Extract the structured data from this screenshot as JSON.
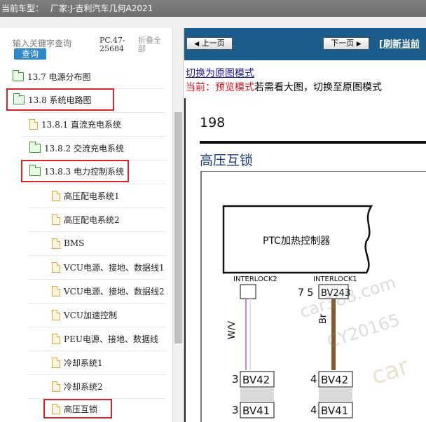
{
  "title_bar": {
    "vehicle_label": "当前车型：",
    "manufacturer": "厂家:J-吉利汽车几何A2021"
  },
  "left_panel": {
    "search_placeholder": "输入关键字查询",
    "query_button": "查询",
    "version_line1": "PC.47-",
    "version_line2": "25684",
    "collapse_line1": "折叠全",
    "collapse_line2": "部",
    "tree": [
      {
        "label": "13.7 电源分布图",
        "icon": "folder-icon"
      },
      {
        "label": "13.8 系统电路图",
        "icon": "folder-icon",
        "highlighted": true
      },
      {
        "label": "13.8.1 直流充电系统",
        "icon": "page-icon"
      },
      {
        "label": "13.8.2 交流充电系统",
        "icon": "folder-icon"
      },
      {
        "label": "13.8.3 电力控制系统",
        "icon": "folder-icon",
        "highlighted": true
      },
      {
        "label": "高压配电系统1",
        "icon": "page-icon"
      },
      {
        "label": "高压配电系统2",
        "icon": "page-icon"
      },
      {
        "label": "BMS",
        "icon": "page-icon"
      },
      {
        "label": "VCU电源、接地、数据线1",
        "icon": "page-icon"
      },
      {
        "label": "VCU电源、接地、数据线2",
        "icon": "page-icon"
      },
      {
        "label": "VCU加速控制",
        "icon": "page-icon"
      },
      {
        "label": "PEU电源、接地、数据线",
        "icon": "page-icon"
      },
      {
        "label": "冷却系统1",
        "icon": "page-icon"
      },
      {
        "label": "冷却系统2",
        "icon": "page-icon"
      },
      {
        "label": "高压互锁",
        "icon": "page-icon",
        "highlighted": true
      }
    ]
  },
  "viewer": {
    "prev_button": "上一页",
    "next_button": "下一页",
    "refresh_link": "[刷新当前",
    "switch_link": "切换为原图模式",
    "current_prefix": "当前：",
    "current_mode": "预览模式",
    "hint": "若需看大图，切换至原图模式",
    "page_number": "198",
    "section_title": "高压互锁",
    "diagram": {
      "module_name": "PTC加热控制器",
      "pin_left_label": "INTERLOCK2",
      "pin_right_label": "INTERLOCK1",
      "pin_right_numbers": "7 5",
      "connector_top": "BV243",
      "wire_left": "W/V",
      "wire_right": "Br",
      "row1_left_pin": "3",
      "row1_left_conn": "BV42",
      "row1_right_pin": "4",
      "row1_right_conn": "BV42",
      "row2_left_pin": "3",
      "row2_left_conn": "BV41",
      "row2_right_pin": "4",
      "row2_right_conn": "BV41"
    },
    "watermarks": [
      "car388.com",
      "CY20165",
      "car"
    ]
  },
  "colors": {
    "highlight_border": "#d9242c",
    "nav_bar": "#1a5d8c",
    "query_button": "#2d87c8",
    "wire_left": "#b58bd6",
    "wire_right": "#8b5a2b"
  }
}
